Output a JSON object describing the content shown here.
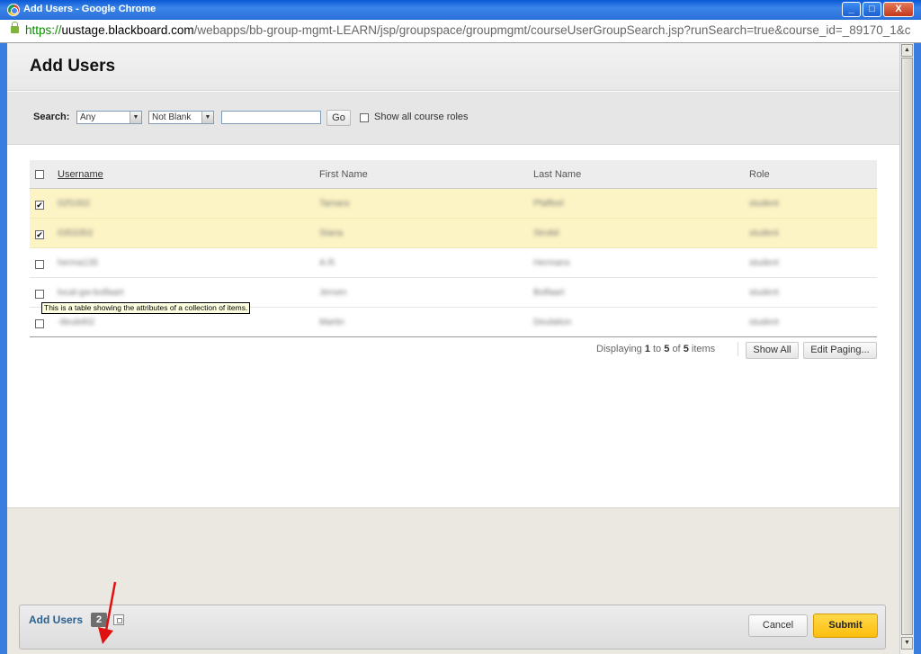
{
  "window": {
    "title": "Add Users - Google Chrome",
    "min_glyph": "_",
    "max_glyph": "□",
    "close_glyph": "X"
  },
  "address": {
    "scheme": "https://",
    "host": "uustage.blackboard.com",
    "path": "/webapps/bb-group-mgmt-LEARN/jsp/groupspace/groupmgmt/courseUserGroupSearch.jsp?runSearch=true&course_id=_89170_1&c"
  },
  "page": {
    "title": "Add Users"
  },
  "search": {
    "label": "Search:",
    "field_value": "Any",
    "operator_value": "Not Blank",
    "query_value": "",
    "go_label": "Go",
    "show_roles_label": "Show all course roles",
    "show_roles_checked": false
  },
  "table": {
    "columns": {
      "username": "Username",
      "first_name": "First Name",
      "last_name": "Last Name",
      "role": "Role"
    },
    "rows": [
      {
        "checked": "✔",
        "username": "02f1002",
        "first_name": "Tamara",
        "last_name": "Pfaffeel",
        "role": "student"
      },
      {
        "checked": "✔",
        "username": "0353353",
        "first_name": "Stana",
        "last_name": "Strobil",
        "role": "student"
      },
      {
        "checked": "",
        "username": "herma135",
        "first_name": "A.R.",
        "last_name": "Hermans",
        "role": "student"
      },
      {
        "checked": "",
        "username": "local-gw-bolfaart",
        "first_name": "Jeroen",
        "last_name": "Bolfaart",
        "role": "student"
      },
      {
        "checked": "",
        "username": "-8eulel02",
        "first_name": "Martin",
        "last_name": "Deulation",
        "role": "student"
      }
    ],
    "tooltip": "This is a table showing the attributes of a collection of items."
  },
  "paging": {
    "prefix": "Displaying",
    "from": "1",
    "to_word": "to",
    "to": "5",
    "of_word": "of",
    "total": "5",
    "suffix": "items",
    "show_all_label": "Show All",
    "edit_paging_label": "Edit Paging..."
  },
  "submit_bar": {
    "title": "Add Users",
    "count": "2",
    "cancel_label": "Cancel",
    "submit_label": "Submit"
  },
  "colors": {
    "selected_row": "#fdf4c5",
    "submit_button": "#fdbe0d",
    "annotation_arrow": "#e01010",
    "title_bar": "#0a58d6"
  }
}
